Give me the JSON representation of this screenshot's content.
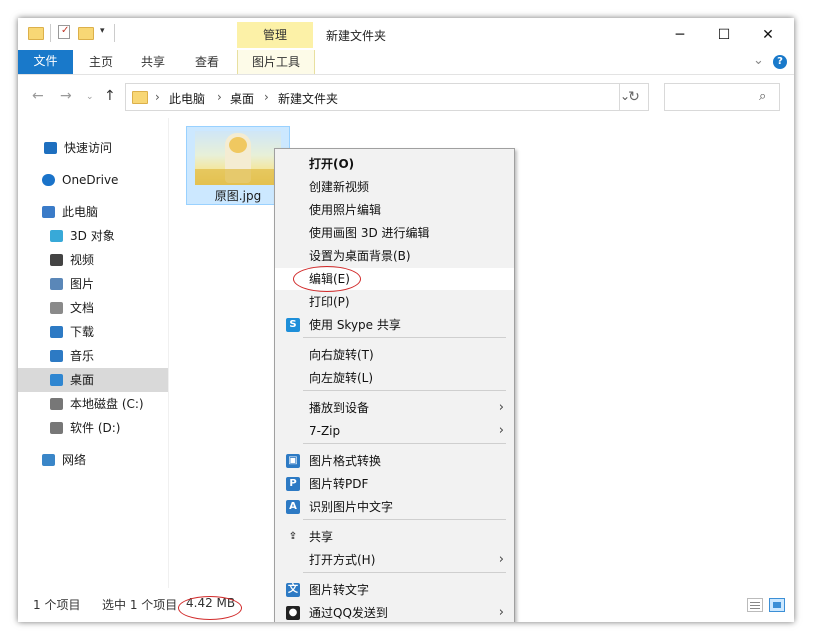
{
  "window": {
    "title": "新建文件夹",
    "context_tab": "管理",
    "controls": {
      "minimize": "─",
      "maximize": "☐",
      "close": "✕"
    }
  },
  "ribbon": {
    "file": "文件",
    "tabs": [
      "主页",
      "共享",
      "查看"
    ],
    "picture_tools": "图片工具",
    "help": "?",
    "expand": "⌄"
  },
  "address": {
    "breadcrumb": [
      "此电脑",
      "桌面",
      "新建文件夹"
    ],
    "separator": "›",
    "search_placeholder": ""
  },
  "sidebar": {
    "items": [
      {
        "label": "快速访问",
        "icon": "star-icon"
      },
      {
        "label": "OneDrive",
        "icon": "cloud-icon"
      },
      {
        "label": "此电脑",
        "icon": "computer-icon"
      },
      {
        "label": "3D 对象",
        "icon": "cube-icon"
      },
      {
        "label": "视频",
        "icon": "film-icon"
      },
      {
        "label": "图片",
        "icon": "picture-icon"
      },
      {
        "label": "文档",
        "icon": "document-icon"
      },
      {
        "label": "下载",
        "icon": "download-icon"
      },
      {
        "label": "音乐",
        "icon": "music-icon"
      },
      {
        "label": "桌面",
        "icon": "desktop-icon",
        "selected": true
      },
      {
        "label": "本地磁盘 (C:)",
        "icon": "drive-icon"
      },
      {
        "label": "软件 (D:)",
        "icon": "drive-icon"
      },
      {
        "label": "网络",
        "icon": "network-icon"
      }
    ]
  },
  "file": {
    "name": "原图.jpg"
  },
  "context_menu": {
    "items": [
      {
        "label": "打开(O)",
        "bold": true
      },
      {
        "label": "创建新视频"
      },
      {
        "label": "使用照片编辑"
      },
      {
        "label": "使用画图 3D 进行编辑"
      },
      {
        "label": "设置为桌面背景(B)"
      },
      {
        "label": "编辑(E)",
        "highlighted": true
      },
      {
        "label": "打印(P)"
      },
      {
        "label": "使用 Skype 共享",
        "icon": "skype-icon"
      },
      {
        "label": "向右旋转(T)"
      },
      {
        "label": "向左旋转(L)"
      },
      {
        "label": "播放到设备",
        "submenu": true
      },
      {
        "label": "7-Zip",
        "submenu": true
      },
      {
        "label": "图片格式转换",
        "icon": "image-convert-icon"
      },
      {
        "label": "图片转PDF",
        "icon": "pdf-icon"
      },
      {
        "label": "识别图片中文字",
        "icon": "ocr-icon"
      },
      {
        "label": "共享",
        "icon": "share-icon"
      },
      {
        "label": "打开方式(H)",
        "submenu": true
      },
      {
        "label": "图片转文字",
        "icon": "image-to-text-icon"
      },
      {
        "label": "通过QQ发送到",
        "submenu": true,
        "icon": "qq-icon"
      }
    ],
    "arrow": "›"
  },
  "status": {
    "item_count": "1 个项目",
    "selected": "选中 1 个项目",
    "size": "4.42 MB"
  },
  "colors": {
    "accent": "#1979ca",
    "annotation": "#d12a2a",
    "selection": "#cce8ff"
  }
}
